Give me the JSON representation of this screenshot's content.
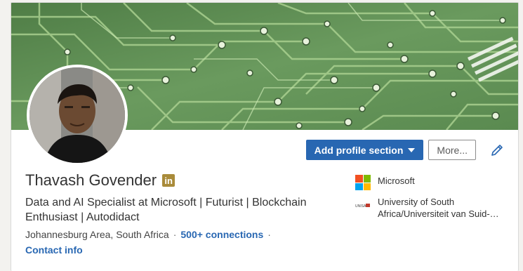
{
  "profile": {
    "name": "Thavash Govender",
    "badge_icon": "linkedin-premium-icon",
    "headline": "Data and AI Specialist at Microsoft | Futurist | Blockchain Enthusiast | Autodidact",
    "location": "Johannesburg Area, South Africa",
    "separator": "·",
    "connections": "500+ connections",
    "contact_info": "Contact info"
  },
  "actions": {
    "add_section_label": "Add profile section",
    "more_label": "More...",
    "edit_icon": "pencil-icon"
  },
  "orgs": [
    {
      "name": "Microsoft",
      "logo_icon": "microsoft-logo-icon"
    },
    {
      "name": "University of South Africa/Universiteit van Suid-Afrika",
      "logo_icon": "unisa-logo-icon"
    }
  ],
  "colors": {
    "accent": "#2867b2",
    "banner_green": "#5f8c55",
    "badge_gold": "#a98b3a",
    "ms_red": "#f25022",
    "ms_green": "#7fba00",
    "ms_blue": "#00a4ef",
    "ms_yellow": "#ffb900"
  }
}
